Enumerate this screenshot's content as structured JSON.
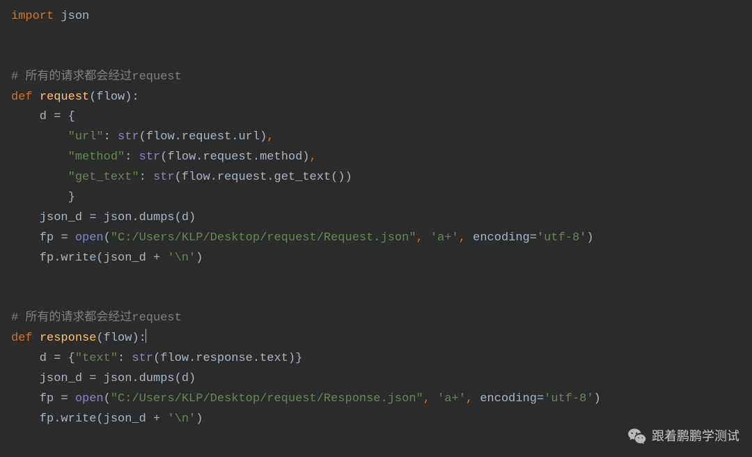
{
  "colors": {
    "background": "#2b2b2b",
    "keyword": "#cc7832",
    "function": "#ffc66d",
    "string": "#6a8759",
    "comment": "#808080",
    "builtin": "#8888c6",
    "default": "#a9b7c6"
  },
  "code": {
    "l01_kw_import": "import",
    "l01_module": " json",
    "l04_comment": "# 所有的请求都会经过request",
    "l05_kw_def": "def",
    "l05_fn": "request",
    "l05_params": "(flow):",
    "l06_indent": "    d = {",
    "l07_indent": "        ",
    "l07_key": "\"url\"",
    "l07_sep": ": ",
    "l07_builtin": "str",
    "l07_rest": "(flow.request.url)",
    "l07_comma": ",",
    "l08_indent": "        ",
    "l08_key": "\"method\"",
    "l08_sep": ": ",
    "l08_builtin": "str",
    "l08_rest": "(flow.request.method)",
    "l08_comma": ",",
    "l09_indent": "        ",
    "l09_key": "\"get_text\"",
    "l09_sep": ": ",
    "l09_builtin": "str",
    "l09_rest": "(flow.request.get_text())",
    "l10_close": "        }",
    "l11_indent": "    json_d = json.dumps(d)",
    "l12_indent": "    fp = ",
    "l12_builtin": "open",
    "l12_open": "(",
    "l12_path": "\"C:/Users/KLP/Desktop/request/Request.json\"",
    "l12_sep1": ", ",
    "l12_mode": "'a+'",
    "l12_sep2": ", ",
    "l12_kwarg": "encoding",
    "l12_eq": "=",
    "l12_enc": "'utf-8'",
    "l12_close": ")",
    "l13_indent": "    fp.write(json_d + ",
    "l13_nl": "'\\n'",
    "l13_close": ")",
    "l16_comment": "# 所有的请求都会经过request",
    "l17_kw_def": "def",
    "l17_fn": "response",
    "l17_params": "(flow):",
    "l18_indent": "    d = {",
    "l18_key": "\"text\"",
    "l18_sep": ": ",
    "l18_builtin": "str",
    "l18_rest": "(flow.response.text)}",
    "l19_indent": "    json_d = json.dumps(d)",
    "l20_indent": "    fp = ",
    "l20_builtin": "open",
    "l20_open": "(",
    "l20_path": "\"C:/Users/KLP/Desktop/request/Response.json\"",
    "l20_sep1": ", ",
    "l20_mode": "'a+'",
    "l20_sep2": ", ",
    "l20_kwarg": "encoding",
    "l20_eq": "=",
    "l20_enc": "'utf-8'",
    "l20_close": ")",
    "l21_indent": "    fp.write(json_d + ",
    "l21_nl": "'\\n'",
    "l21_close": ")"
  },
  "watermark": {
    "text": "跟着鹏鹏学测试"
  }
}
